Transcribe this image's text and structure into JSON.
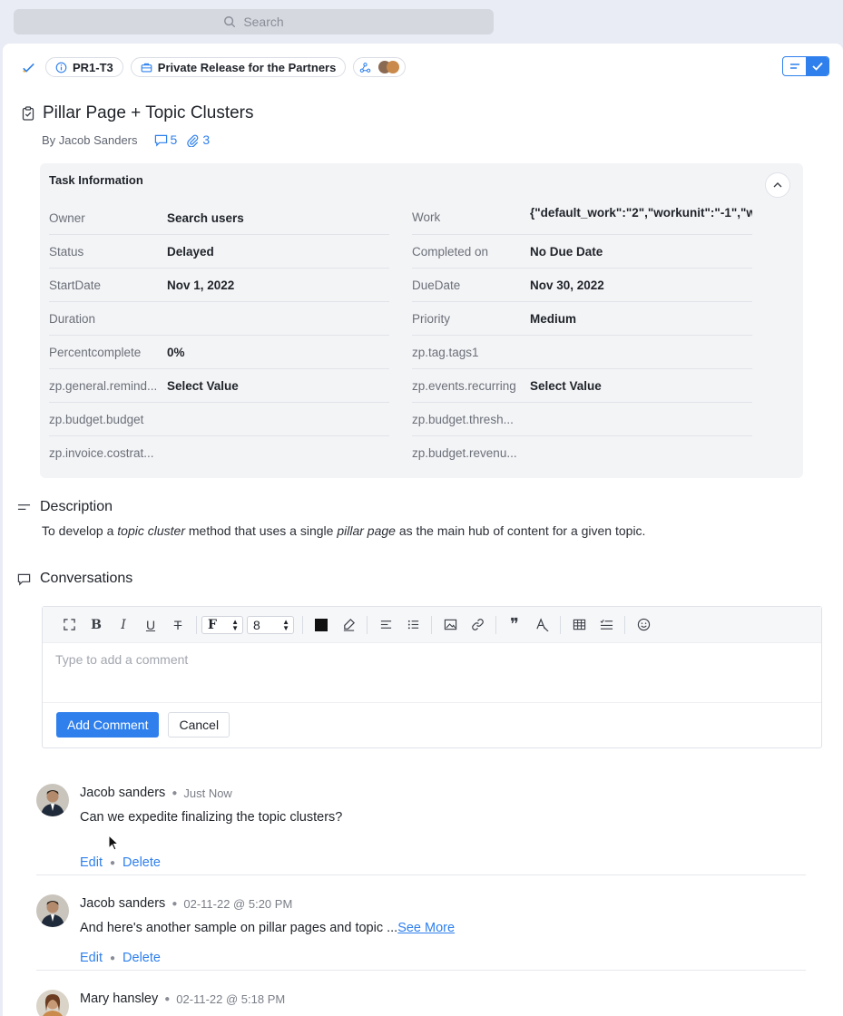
{
  "search": {
    "placeholder": "Search"
  },
  "header": {
    "task_id": "PR1-T3",
    "project": "Private Release for the Partners"
  },
  "task": {
    "title": "Pillar Page + Topic Clusters",
    "author": "By Jacob Sanders",
    "comment_count": "5",
    "attachment_count": "3"
  },
  "task_info": {
    "heading": "Task Information",
    "left": [
      {
        "label": "Owner",
        "value": "Search users"
      },
      {
        "label": "Status",
        "value": "Delayed"
      },
      {
        "label": "StartDate",
        "value": "Nov 1, 2022"
      },
      {
        "label": "Duration",
        "value": ""
      },
      {
        "label": "Percentcomplete",
        "value": "0%"
      },
      {
        "label": "zp.general.remind...",
        "value": "Select Value"
      },
      {
        "label": "zp.budget.budget",
        "value": ""
      },
      {
        "label": "zp.invoice.costrat...",
        "value": ""
      }
    ],
    "right": [
      {
        "label": "Work",
        "value": "{\"default_work\":\"2\",\"workunit\":\"-1\",\"w"
      },
      {
        "label": "Completed on",
        "value": "No Due Date"
      },
      {
        "label": "DueDate",
        "value": "Nov 30, 2022"
      },
      {
        "label": "Priority",
        "value": "Medium"
      },
      {
        "label": "zp.tag.tags1",
        "value": ""
      },
      {
        "label": "zp.events.recurring",
        "value": "Select Value"
      },
      {
        "label": "zp.budget.thresh...",
        "value": ""
      },
      {
        "label": "zp.budget.revenu...",
        "value": ""
      }
    ]
  },
  "description": {
    "heading": "Description",
    "text_1": "To develop a ",
    "em_1": "topic cluster",
    "text_2": " method that uses a single ",
    "em_2": "pillar page",
    "text_3": " as the main hub of content for a given topic."
  },
  "conversations": {
    "heading": "Conversations",
    "toolbar": {
      "font_value": "F",
      "size_value": "8"
    },
    "comment_placeholder": "Type to add a comment",
    "add_label": "Add Comment",
    "cancel_label": "Cancel",
    "comments": [
      {
        "author": "Jacob sanders",
        "time": "Just Now",
        "text": "Can we expedite finalizing the topic clusters?",
        "edit": "Edit",
        "delete": "Delete"
      },
      {
        "author": "Jacob sanders",
        "time": "02-11-22 @ 5:20 PM",
        "text": "And here's another sample on pillar pages and topic ...",
        "more": "See More",
        "edit": "Edit",
        "delete": "Delete"
      },
      {
        "author": "Mary hansley",
        "time": "02-11-22 @ 5:18 PM"
      }
    ]
  },
  "colors": {
    "accent": "#2f80ed",
    "card_bg": "#f3f4f6",
    "page_bg": "#e9ebf5"
  }
}
